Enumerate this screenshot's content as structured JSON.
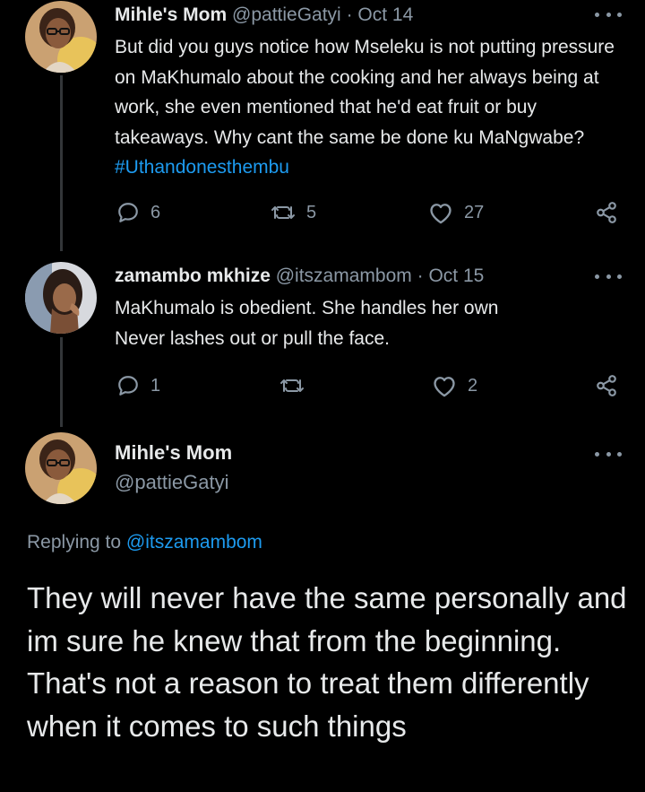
{
  "tweets": [
    {
      "display_name": "Mihle's Mom",
      "handle": "@pattieGatyi",
      "separator": "·",
      "date": "Oct 14",
      "text_main": "But did you guys notice how Mseleku is not putting pressure on MaKhumalo about the cooking and her always being at work, she even mentioned that he'd eat fruit or buy takeaways. Why cant the same be done ku MaNgwabe? ",
      "hashtag": "#Uthandonesthembu",
      "reply_count": "6",
      "retweet_count": "5",
      "like_count": "27"
    },
    {
      "display_name": "zamambo mkhize",
      "handle": "@itszamambom",
      "separator": "·",
      "date": "Oct 15",
      "text_main": "MaKhumalo is obedient. She handles her own\n Never lashes out or pull the face.",
      "reply_count": "1",
      "retweet_count": "",
      "like_count": "2"
    }
  ],
  "main_tweet": {
    "display_name": "Mihle's Mom",
    "handle": "@pattieGatyi",
    "replying_prefix": "Replying to",
    "replying_to": "@itszamambom",
    "text": "They will never have the same personally and im sure he knew that from the beginning. That's not a reason to treat them differently when it comes to such things"
  },
  "icons": {
    "reply": "reply-icon",
    "retweet": "retweet-icon",
    "like": "heart-icon",
    "share": "share-icon",
    "more": "more-options-icon"
  },
  "colors": {
    "background": "#000000",
    "text": "#e7e9ea",
    "secondary": "#8b98a5",
    "accent": "#1d9bf0",
    "thread_line": "#333639"
  }
}
